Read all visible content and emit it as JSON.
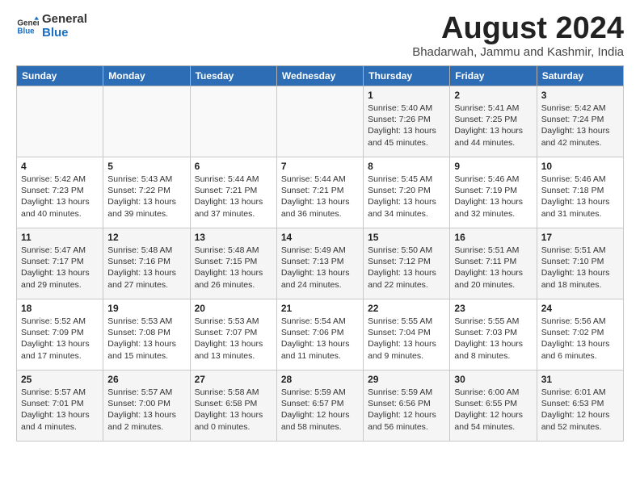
{
  "header": {
    "logo_line1": "General",
    "logo_line2": "Blue",
    "month_year": "August 2024",
    "location": "Bhadarwah, Jammu and Kashmir, India"
  },
  "days_of_week": [
    "Sunday",
    "Monday",
    "Tuesday",
    "Wednesday",
    "Thursday",
    "Friday",
    "Saturday"
  ],
  "weeks": [
    [
      {
        "day": "",
        "info": ""
      },
      {
        "day": "",
        "info": ""
      },
      {
        "day": "",
        "info": ""
      },
      {
        "day": "",
        "info": ""
      },
      {
        "day": "1",
        "info": "Sunrise: 5:40 AM\nSunset: 7:26 PM\nDaylight: 13 hours\nand 45 minutes."
      },
      {
        "day": "2",
        "info": "Sunrise: 5:41 AM\nSunset: 7:25 PM\nDaylight: 13 hours\nand 44 minutes."
      },
      {
        "day": "3",
        "info": "Sunrise: 5:42 AM\nSunset: 7:24 PM\nDaylight: 13 hours\nand 42 minutes."
      }
    ],
    [
      {
        "day": "4",
        "info": "Sunrise: 5:42 AM\nSunset: 7:23 PM\nDaylight: 13 hours\nand 40 minutes."
      },
      {
        "day": "5",
        "info": "Sunrise: 5:43 AM\nSunset: 7:22 PM\nDaylight: 13 hours\nand 39 minutes."
      },
      {
        "day": "6",
        "info": "Sunrise: 5:44 AM\nSunset: 7:21 PM\nDaylight: 13 hours\nand 37 minutes."
      },
      {
        "day": "7",
        "info": "Sunrise: 5:44 AM\nSunset: 7:21 PM\nDaylight: 13 hours\nand 36 minutes."
      },
      {
        "day": "8",
        "info": "Sunrise: 5:45 AM\nSunset: 7:20 PM\nDaylight: 13 hours\nand 34 minutes."
      },
      {
        "day": "9",
        "info": "Sunrise: 5:46 AM\nSunset: 7:19 PM\nDaylight: 13 hours\nand 32 minutes."
      },
      {
        "day": "10",
        "info": "Sunrise: 5:46 AM\nSunset: 7:18 PM\nDaylight: 13 hours\nand 31 minutes."
      }
    ],
    [
      {
        "day": "11",
        "info": "Sunrise: 5:47 AM\nSunset: 7:17 PM\nDaylight: 13 hours\nand 29 minutes."
      },
      {
        "day": "12",
        "info": "Sunrise: 5:48 AM\nSunset: 7:16 PM\nDaylight: 13 hours\nand 27 minutes."
      },
      {
        "day": "13",
        "info": "Sunrise: 5:48 AM\nSunset: 7:15 PM\nDaylight: 13 hours\nand 26 minutes."
      },
      {
        "day": "14",
        "info": "Sunrise: 5:49 AM\nSunset: 7:13 PM\nDaylight: 13 hours\nand 24 minutes."
      },
      {
        "day": "15",
        "info": "Sunrise: 5:50 AM\nSunset: 7:12 PM\nDaylight: 13 hours\nand 22 minutes."
      },
      {
        "day": "16",
        "info": "Sunrise: 5:51 AM\nSunset: 7:11 PM\nDaylight: 13 hours\nand 20 minutes."
      },
      {
        "day": "17",
        "info": "Sunrise: 5:51 AM\nSunset: 7:10 PM\nDaylight: 13 hours\nand 18 minutes."
      }
    ],
    [
      {
        "day": "18",
        "info": "Sunrise: 5:52 AM\nSunset: 7:09 PM\nDaylight: 13 hours\nand 17 minutes."
      },
      {
        "day": "19",
        "info": "Sunrise: 5:53 AM\nSunset: 7:08 PM\nDaylight: 13 hours\nand 15 minutes."
      },
      {
        "day": "20",
        "info": "Sunrise: 5:53 AM\nSunset: 7:07 PM\nDaylight: 13 hours\nand 13 minutes."
      },
      {
        "day": "21",
        "info": "Sunrise: 5:54 AM\nSunset: 7:06 PM\nDaylight: 13 hours\nand 11 minutes."
      },
      {
        "day": "22",
        "info": "Sunrise: 5:55 AM\nSunset: 7:04 PM\nDaylight: 13 hours\nand 9 minutes."
      },
      {
        "day": "23",
        "info": "Sunrise: 5:55 AM\nSunset: 7:03 PM\nDaylight: 13 hours\nand 8 minutes."
      },
      {
        "day": "24",
        "info": "Sunrise: 5:56 AM\nSunset: 7:02 PM\nDaylight: 13 hours\nand 6 minutes."
      }
    ],
    [
      {
        "day": "25",
        "info": "Sunrise: 5:57 AM\nSunset: 7:01 PM\nDaylight: 13 hours\nand 4 minutes."
      },
      {
        "day": "26",
        "info": "Sunrise: 5:57 AM\nSunset: 7:00 PM\nDaylight: 13 hours\nand 2 minutes."
      },
      {
        "day": "27",
        "info": "Sunrise: 5:58 AM\nSunset: 6:58 PM\nDaylight: 13 hours\nand 0 minutes."
      },
      {
        "day": "28",
        "info": "Sunrise: 5:59 AM\nSunset: 6:57 PM\nDaylight: 12 hours\nand 58 minutes."
      },
      {
        "day": "29",
        "info": "Sunrise: 5:59 AM\nSunset: 6:56 PM\nDaylight: 12 hours\nand 56 minutes."
      },
      {
        "day": "30",
        "info": "Sunrise: 6:00 AM\nSunset: 6:55 PM\nDaylight: 12 hours\nand 54 minutes."
      },
      {
        "day": "31",
        "info": "Sunrise: 6:01 AM\nSunset: 6:53 PM\nDaylight: 12 hours\nand 52 minutes."
      }
    ]
  ]
}
